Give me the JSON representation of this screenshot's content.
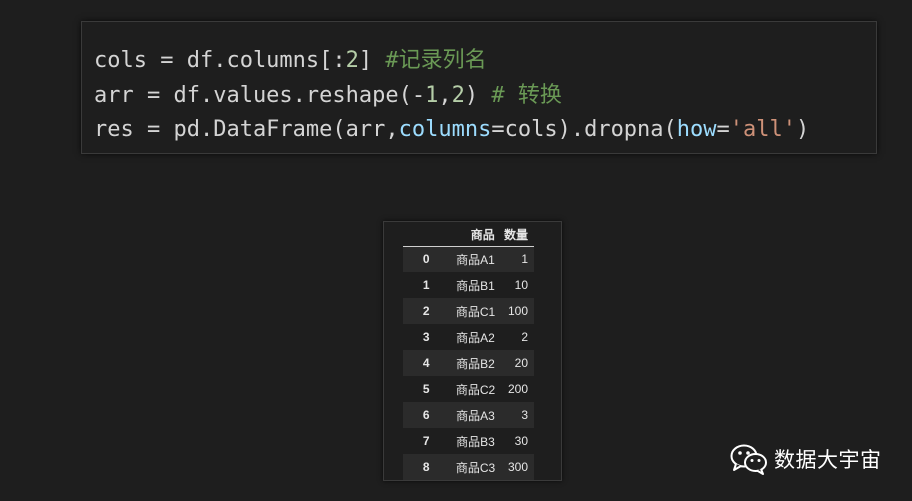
{
  "code": {
    "lines": [
      [
        {
          "text": "cols = df.columns[:",
          "type": "plain"
        },
        {
          "text": "2",
          "type": "number"
        },
        {
          "text": "] ",
          "type": "plain"
        },
        {
          "text": "#记录列名",
          "type": "comment"
        }
      ],
      [
        {
          "text": "arr = df.values.reshape(-",
          "type": "plain"
        },
        {
          "text": "1",
          "type": "number"
        },
        {
          "text": ",",
          "type": "plain"
        },
        {
          "text": "2",
          "type": "number"
        },
        {
          "text": ") ",
          "type": "plain"
        },
        {
          "text": "# 转换",
          "type": "comment"
        }
      ],
      [
        {
          "text": "res = pd.DataFrame(arr,",
          "type": "plain"
        },
        {
          "text": "columns",
          "type": "param"
        },
        {
          "text": "=cols).dropna(",
          "type": "plain"
        },
        {
          "text": "how",
          "type": "param"
        },
        {
          "text": "=",
          "type": "plain"
        },
        {
          "text": "'all'",
          "type": "string"
        },
        {
          "text": ")",
          "type": "plain"
        }
      ]
    ]
  },
  "dataframe": {
    "index_header": "",
    "columns": [
      "商品",
      "数量"
    ],
    "rows": [
      {
        "index": "0",
        "name": "商品A1",
        "qty": "1"
      },
      {
        "index": "1",
        "name": "商品B1",
        "qty": "10"
      },
      {
        "index": "2",
        "name": "商品C1",
        "qty": "100"
      },
      {
        "index": "3",
        "name": "商品A2",
        "qty": "2"
      },
      {
        "index": "4",
        "name": "商品B2",
        "qty": "20"
      },
      {
        "index": "5",
        "name": "商品C2",
        "qty": "200"
      },
      {
        "index": "6",
        "name": "商品A3",
        "qty": "3"
      },
      {
        "index": "7",
        "name": "商品B3",
        "qty": "30"
      },
      {
        "index": "8",
        "name": "商品C3",
        "qty": "300"
      }
    ]
  },
  "watermark": {
    "icon": "wechat-icon",
    "text": "数据大宇宙"
  },
  "colors": {
    "background": "#1e1e1e",
    "comment": "#6a9955",
    "number": "#b5cea8",
    "param": "#9cdcfe",
    "string": "#ce9178"
  }
}
